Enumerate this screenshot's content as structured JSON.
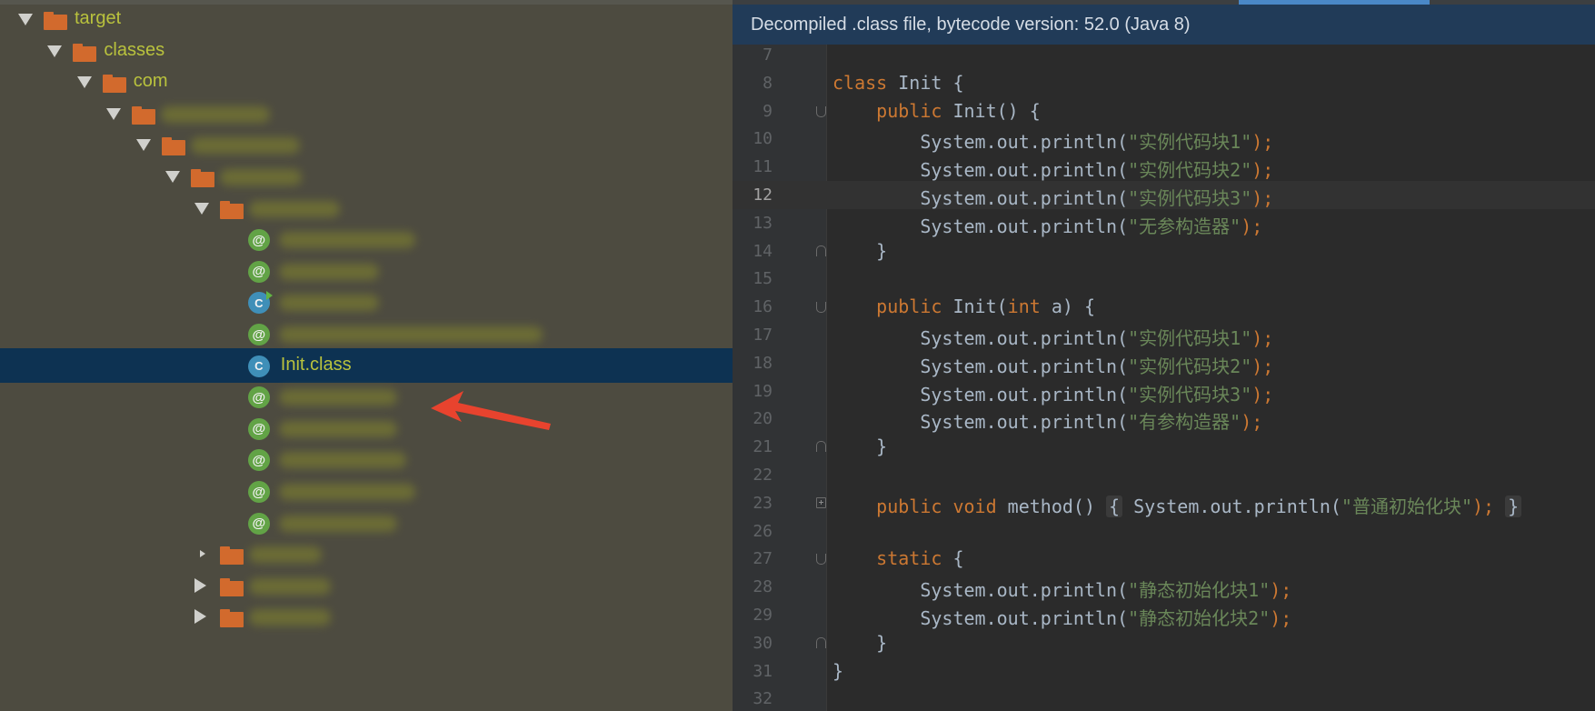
{
  "tree": {
    "items": [
      {
        "label": "target",
        "kind": "folder",
        "toggle": "down",
        "blurred": false
      },
      {
        "label": "classes",
        "kind": "folder",
        "toggle": "down",
        "blurred": false
      },
      {
        "label": "com",
        "kind": "folder",
        "toggle": "down",
        "blurred": false
      },
      {
        "label": "",
        "kind": "folder",
        "toggle": "down",
        "blurred": true
      },
      {
        "label": "",
        "kind": "folder",
        "toggle": "down",
        "blurred": true
      },
      {
        "label": "",
        "kind": "folder",
        "toggle": "down",
        "blurred": true
      },
      {
        "label": "",
        "kind": "folder",
        "toggle": "down",
        "blurred": true
      },
      {
        "label": "",
        "kind": "annotation",
        "blurred": true
      },
      {
        "label": "",
        "kind": "annotation",
        "blurred": true
      },
      {
        "label": "",
        "kind": "class",
        "blurred": true,
        "runnable": true
      },
      {
        "label": "",
        "kind": "annotation",
        "blurred": true
      },
      {
        "label": "Init.class",
        "kind": "class",
        "blurred": false,
        "selected": true
      },
      {
        "label": "",
        "kind": "annotation",
        "blurred": true
      },
      {
        "label": "",
        "kind": "annotation",
        "blurred": true
      },
      {
        "label": "",
        "kind": "annotation",
        "blurred": true
      },
      {
        "label": "",
        "kind": "annotation",
        "blurred": true
      },
      {
        "label": "",
        "kind": "annotation",
        "blurred": true
      },
      {
        "label": "",
        "kind": "folder",
        "toggle": "small",
        "blurred": true
      },
      {
        "label": "",
        "kind": "folder",
        "toggle": "right",
        "blurred": true
      },
      {
        "label": "",
        "kind": "folder",
        "toggle": "right",
        "blurred": true
      }
    ],
    "anno_glyph": "@",
    "class_glyph": "C"
  },
  "editor": {
    "banner": "Decompiled .class file, bytecode version: 52.0 (Java 8)",
    "current_line": "12",
    "lines": [
      {
        "num": "7",
        "tokens": []
      },
      {
        "num": "8",
        "tokens": [
          {
            "t": "class",
            "c": "kw"
          },
          {
            "t": " Init {",
            "c": "plain"
          }
        ]
      },
      {
        "num": "9",
        "tokens": [
          {
            "t": "    public",
            "c": "kw"
          },
          {
            "t": " Init() {",
            "c": "plain"
          }
        ],
        "fold": "open"
      },
      {
        "num": "10",
        "tokens": [
          {
            "t": "        System.out.println(",
            "c": "plain"
          },
          {
            "t": "\"实例代码块1\"",
            "c": "str"
          },
          {
            "t": ");",
            "c": "kw"
          }
        ]
      },
      {
        "num": "11",
        "tokens": [
          {
            "t": "        System.out.println(",
            "c": "plain"
          },
          {
            "t": "\"实例代码块2\"",
            "c": "str"
          },
          {
            "t": ");",
            "c": "kw"
          }
        ]
      },
      {
        "num": "12",
        "tokens": [
          {
            "t": "        System.out.println(",
            "c": "plain"
          },
          {
            "t": "\"实例代码块3\"",
            "c": "str"
          },
          {
            "t": ");",
            "c": "kw"
          }
        ]
      },
      {
        "num": "13",
        "tokens": [
          {
            "t": "        System.out.println(",
            "c": "plain"
          },
          {
            "t": "\"无参构造器\"",
            "c": "str"
          },
          {
            "t": ");",
            "c": "kw"
          }
        ]
      },
      {
        "num": "14",
        "tokens": [
          {
            "t": "    }",
            "c": "plain"
          }
        ],
        "fold": "close"
      },
      {
        "num": "15",
        "tokens": []
      },
      {
        "num": "16",
        "tokens": [
          {
            "t": "    public",
            "c": "kw"
          },
          {
            "t": " Init(",
            "c": "plain"
          },
          {
            "t": "int",
            "c": "kw"
          },
          {
            "t": " a) {",
            "c": "plain"
          }
        ],
        "fold": "open"
      },
      {
        "num": "17",
        "tokens": [
          {
            "t": "        System.out.println(",
            "c": "plain"
          },
          {
            "t": "\"实例代码块1\"",
            "c": "str"
          },
          {
            "t": ");",
            "c": "kw"
          }
        ]
      },
      {
        "num": "18",
        "tokens": [
          {
            "t": "        System.out.println(",
            "c": "plain"
          },
          {
            "t": "\"实例代码块2\"",
            "c": "str"
          },
          {
            "t": ");",
            "c": "kw"
          }
        ]
      },
      {
        "num": "19",
        "tokens": [
          {
            "t": "        System.out.println(",
            "c": "plain"
          },
          {
            "t": "\"实例代码块3\"",
            "c": "str"
          },
          {
            "t": ");",
            "c": "kw"
          }
        ]
      },
      {
        "num": "20",
        "tokens": [
          {
            "t": "        System.out.println(",
            "c": "plain"
          },
          {
            "t": "\"有参构造器\"",
            "c": "str"
          },
          {
            "t": ");",
            "c": "kw"
          }
        ]
      },
      {
        "num": "21",
        "tokens": [
          {
            "t": "    }",
            "c": "plain"
          }
        ],
        "fold": "close"
      },
      {
        "num": "22",
        "tokens": []
      },
      {
        "num": "23",
        "tokens": [
          {
            "t": "    public void",
            "c": "kw"
          },
          {
            "t": " method() ",
            "c": "plain"
          },
          {
            "t": "{",
            "c": "foldbox"
          },
          {
            "t": " System.out.println(",
            "c": "plain"
          },
          {
            "t": "\"普通初始化块\"",
            "c": "str"
          },
          {
            "t": ");",
            "c": "kw"
          },
          {
            "t": " ",
            "c": "plain"
          },
          {
            "t": "}",
            "c": "foldbox"
          }
        ],
        "fold": "plus"
      },
      {
        "num": "26",
        "tokens": []
      },
      {
        "num": "27",
        "tokens": [
          {
            "t": "    static",
            "c": "kw"
          },
          {
            "t": " {",
            "c": "plain"
          }
        ],
        "fold": "open"
      },
      {
        "num": "28",
        "tokens": [
          {
            "t": "        System.out.println(",
            "c": "plain"
          },
          {
            "t": "\"静态初始化块1\"",
            "c": "str"
          },
          {
            "t": ");",
            "c": "kw"
          }
        ]
      },
      {
        "num": "29",
        "tokens": [
          {
            "t": "        System.out.println(",
            "c": "plain"
          },
          {
            "t": "\"静态初始化块2\"",
            "c": "str"
          },
          {
            "t": ");",
            "c": "kw"
          }
        ]
      },
      {
        "num": "30",
        "tokens": [
          {
            "t": "    }",
            "c": "plain"
          }
        ],
        "fold": "close"
      },
      {
        "num": "31",
        "tokens": [
          {
            "t": "}",
            "c": "plain"
          }
        ]
      },
      {
        "num": "32",
        "tokens": []
      }
    ]
  },
  "colors": {
    "tree_bg": "#4d4b40",
    "selection": "#0d3252",
    "banner_bg": "#213b58",
    "keyword": "#cc7832",
    "string": "#6a8759",
    "arrow": "#e8432e"
  }
}
